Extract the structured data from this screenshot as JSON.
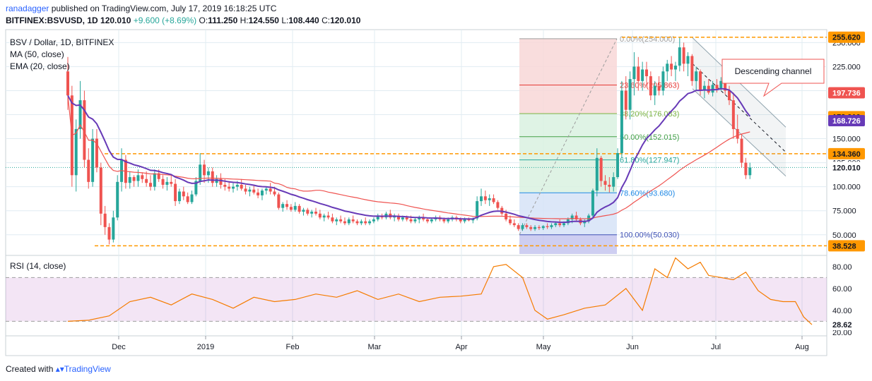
{
  "header": {
    "author": "ranadagger",
    "published_text": "published on TradingView.com, July 17, 2019 16:18:25 UTC",
    "symbol": "BITFINEX:BSVUSD, 1D",
    "close_val": "120.010",
    "change": "+9.600 (+8.69%)",
    "o_label": "O:",
    "o_val": "111.250",
    "h_label": "H:",
    "h_val": "124.550",
    "l_label": "L:",
    "l_val": "108.440",
    "c_label": "C:",
    "c_val": "120.010"
  },
  "legend": {
    "title": "BSV / Dollar, 1D, BITFINEX",
    "ma": "MA (50, close)",
    "ema": "EMA (20, close)",
    "rsi": "RSI (14, close)"
  },
  "footer": {
    "created_with": "Created with",
    "brand": "TradingView"
  },
  "colors": {
    "up": "#26a69a",
    "down": "#ef5350",
    "ma": "#ef5350",
    "ema": "#673ab7",
    "rsi": "#f57c00",
    "level": "#ff9800",
    "axis_text": "#131722",
    "grid": "#e1ecf2",
    "fib_red": "#f8d7d7",
    "fib_green": "#d9f1e0",
    "fib_blue": "#d6e3f7",
    "fib_purple": "#c5c5ef"
  },
  "chart_data": [
    {
      "type": "candlestick",
      "title": "BSV / Dollar, 1D, BITFINEX",
      "x_ticks": [
        "Dec",
        "2019",
        "Feb",
        "Mar",
        "Apr",
        "May",
        "Jun",
        "Jul",
        "Aug"
      ],
      "y_ticks": [
        "50.000",
        "75.000",
        "100.000",
        "125.000",
        "150.000",
        "175.000",
        "200.000",
        "225.000",
        "250.000"
      ],
      "ylim": [
        30,
        262
      ],
      "price_labels": [
        {
          "text": "255.620",
          "value": 255.62,
          "kind": "orange"
        },
        {
          "text": "197.736",
          "value": 197.736,
          "kind": "red"
        },
        {
          "text": "172.910",
          "value": 172.91,
          "kind": "orange"
        },
        {
          "text": "168.726",
          "value": 168.726,
          "kind": "purple"
        },
        {
          "text": "134.360",
          "value": 134.36,
          "kind": "orange"
        },
        {
          "text": "120.010",
          "value": 120.01,
          "kind": "teal"
        },
        {
          "text": "38.528",
          "value": 38.528,
          "kind": "orange"
        }
      ],
      "horizontal_levels": [
        255.62,
        134.36,
        38.528
      ],
      "fibonacci": [
        {
          "label": "0.00%(254.000)",
          "value": 254.0
        },
        {
          "label": "23.60%(205.863)",
          "value": 205.863
        },
        {
          "label": "38.20%(176.083)",
          "value": 176.083
        },
        {
          "label": "50.00%(152.015)",
          "value": 152.015
        },
        {
          "label": "61.80%(127.947)",
          "value": 127.947
        },
        {
          "label": "78.60%(93.680)",
          "value": 93.68
        },
        {
          "label": "100.00%(50.030)",
          "value": 50.03
        }
      ],
      "annotation": "Descending channel",
      "candles": [
        [
          220,
          235,
          180,
          195
        ],
        [
          195,
          205,
          100,
          112
        ],
        [
          112,
          170,
          95,
          160
        ],
        [
          160,
          210,
          150,
          190
        ],
        [
          190,
          200,
          120,
          128
        ],
        [
          128,
          140,
          98,
          105
        ],
        [
          105,
          160,
          100,
          150
        ],
        [
          150,
          160,
          115,
          120
        ],
        [
          120,
          125,
          60,
          72
        ],
        [
          72,
          80,
          50,
          58
        ],
        [
          58,
          62,
          40,
          45
        ],
        [
          45,
          75,
          42,
          68
        ],
        [
          68,
          112,
          65,
          105
        ],
        [
          105,
          140,
          95,
          128
        ],
        [
          128,
          133,
          98,
          104
        ],
        [
          104,
          116,
          98,
          110
        ],
        [
          110,
          112,
          100,
          106
        ],
        [
          106,
          118,
          100,
          112
        ],
        [
          112,
          115,
          104,
          108
        ],
        [
          108,
          116,
          100,
          104
        ],
        [
          104,
          112,
          96,
          100
        ],
        [
          100,
          118,
          96,
          114
        ],
        [
          114,
          118,
          105,
          108
        ],
        [
          108,
          112,
          98,
          102
        ],
        [
          102,
          110,
          96,
          105
        ],
        [
          105,
          112,
          100,
          103
        ],
        [
          103,
          108,
          80,
          85
        ],
        [
          85,
          98,
          82,
          95
        ],
        [
          95,
          100,
          86,
          90
        ],
        [
          90,
          94,
          82,
          84
        ],
        [
          84,
          96,
          82,
          92
        ],
        [
          92,
          110,
          90,
          106
        ],
        [
          106,
          135,
          102,
          123
        ],
        [
          123,
          128,
          104,
          112
        ],
        [
          112,
          120,
          104,
          116
        ],
        [
          116,
          120,
          100,
          104
        ],
        [
          104,
          112,
          100,
          108
        ],
        [
          108,
          114,
          98,
          102
        ],
        [
          102,
          108,
          96,
          100
        ],
        [
          100,
          106,
          95,
          98
        ],
        [
          98,
          104,
          94,
          100
        ],
        [
          100,
          106,
          96,
          102
        ],
        [
          102,
          108,
          96,
          98
        ],
        [
          98,
          102,
          92,
          95
        ],
        [
          95,
          100,
          90,
          97
        ],
        [
          97,
          102,
          92,
          94
        ],
        [
          94,
          98,
          88,
          91
        ],
        [
          91,
          98,
          86,
          96
        ],
        [
          96,
          100,
          92,
          98
        ],
        [
          98,
          104,
          92,
          95
        ],
        [
          95,
          100,
          90,
          92
        ],
        [
          92,
          94,
          76,
          78
        ],
        [
          78,
          84,
          74,
          82
        ],
        [
          82,
          86,
          76,
          79
        ],
        [
          79,
          82,
          74,
          76
        ],
        [
          76,
          84,
          74,
          80
        ],
        [
          80,
          82,
          72,
          74
        ],
        [
          74,
          78,
          70,
          76
        ],
        [
          76,
          78,
          70,
          72
        ],
        [
          72,
          76,
          68,
          74
        ],
        [
          74,
          78,
          70,
          72
        ],
        [
          72,
          76,
          66,
          68
        ],
        [
          68,
          72,
          64,
          70
        ],
        [
          70,
          74,
          66,
          68
        ],
        [
          68,
          72,
          62,
          64
        ],
        [
          64,
          68,
          60,
          66
        ],
        [
          66,
          70,
          62,
          64
        ],
        [
          64,
          68,
          60,
          62
        ],
        [
          62,
          68,
          60,
          66
        ],
        [
          66,
          70,
          62,
          64
        ],
        [
          64,
          66,
          60,
          62
        ],
        [
          62,
          66,
          60,
          64
        ],
        [
          64,
          68,
          60,
          62
        ],
        [
          62,
          66,
          60,
          64
        ],
        [
          64,
          68,
          62,
          66
        ],
        [
          66,
          72,
          64,
          70
        ],
        [
          70,
          72,
          66,
          68
        ],
        [
          68,
          74,
          66,
          72
        ],
        [
          72,
          76,
          66,
          68
        ],
        [
          68,
          72,
          64,
          70
        ],
        [
          70,
          72,
          64,
          66
        ],
        [
          66,
          70,
          64,
          68
        ],
        [
          68,
          70,
          64,
          66
        ],
        [
          66,
          70,
          62,
          64
        ],
        [
          64,
          68,
          62,
          66
        ],
        [
          66,
          70,
          62,
          68
        ],
        [
          68,
          72,
          64,
          66
        ],
        [
          66,
          68,
          62,
          64
        ],
        [
          64,
          68,
          62,
          66
        ],
        [
          66,
          70,
          64,
          68
        ],
        [
          68,
          70,
          64,
          66
        ],
        [
          66,
          68,
          62,
          64
        ],
        [
          64,
          68,
          62,
          66
        ],
        [
          66,
          70,
          64,
          68
        ],
        [
          68,
          70,
          64,
          66
        ],
        [
          66,
          68,
          62,
          64
        ],
        [
          64,
          68,
          62,
          66
        ],
        [
          66,
          68,
          64,
          65
        ],
        [
          65,
          68,
          62,
          67
        ],
        [
          67,
          90,
          65,
          85
        ],
        [
          85,
          98,
          80,
          90
        ],
        [
          90,
          96,
          82,
          86
        ],
        [
          86,
          92,
          80,
          88
        ],
        [
          88,
          92,
          82,
          84
        ],
        [
          84,
          86,
          76,
          78
        ],
        [
          78,
          80,
          70,
          72
        ],
        [
          72,
          76,
          64,
          66
        ],
        [
          66,
          70,
          60,
          62
        ],
        [
          62,
          66,
          58,
          60
        ],
        [
          60,
          62,
          54,
          56
        ],
        [
          56,
          62,
          54,
          60
        ],
        [
          60,
          62,
          56,
          58
        ],
        [
          58,
          60,
          54,
          56
        ],
        [
          56,
          60,
          54,
          58
        ],
        [
          58,
          60,
          55,
          57
        ],
        [
          57,
          60,
          55,
          59
        ],
        [
          59,
          62,
          56,
          58
        ],
        [
          58,
          62,
          56,
          60
        ],
        [
          60,
          64,
          58,
          62
        ],
        [
          62,
          66,
          58,
          60
        ],
        [
          60,
          64,
          58,
          62
        ],
        [
          62,
          68,
          60,
          66
        ],
        [
          66,
          72,
          62,
          70
        ],
        [
          70,
          74,
          64,
          66
        ],
        [
          66,
          68,
          60,
          62
        ],
        [
          62,
          66,
          58,
          64
        ],
        [
          64,
          72,
          62,
          70
        ],
        [
          70,
          98,
          68,
          96
        ],
        [
          96,
          140,
          90,
          130
        ],
        [
          130,
          132,
          100,
          106
        ],
        [
          106,
          112,
          96,
          102
        ],
        [
          102,
          110,
          94,
          100
        ],
        [
          100,
          115,
          95,
          110
        ],
        [
          110,
          140,
          108,
          135
        ],
        [
          135,
          210,
          130,
          200
        ],
        [
          200,
          215,
          170,
          180
        ],
        [
          180,
          220,
          170,
          212
        ],
        [
          212,
          240,
          195,
          225
        ],
        [
          225,
          235,
          200,
          210
        ],
        [
          210,
          230,
          200,
          222
        ],
        [
          222,
          230,
          205,
          215
        ],
        [
          215,
          220,
          190,
          195
        ],
        [
          195,
          210,
          185,
          205
        ],
        [
          205,
          215,
          195,
          200
        ],
        [
          200,
          225,
          195,
          220
        ],
        [
          220,
          232,
          210,
          228
        ],
        [
          228,
          236,
          215,
          222
        ],
        [
          222,
          230,
          210,
          226
        ],
        [
          226,
          255,
          220,
          245
        ],
        [
          245,
          250,
          220,
          228
        ],
        [
          228,
          240,
          215,
          236
        ],
        [
          236,
          238,
          205,
          210
        ],
        [
          210,
          225,
          200,
          220
        ],
        [
          220,
          222,
          195,
          200
        ],
        [
          200,
          210,
          192,
          205
        ],
        [
          205,
          212,
          196,
          198
        ],
        [
          198,
          210,
          194,
          206
        ],
        [
          206,
          212,
          198,
          202
        ],
        [
          202,
          214,
          200,
          210
        ],
        [
          210,
          212,
          196,
          200
        ],
        [
          200,
          205,
          185,
          190
        ],
        [
          190,
          198,
          150,
          160
        ],
        [
          160,
          175,
          145,
          150
        ],
        [
          150,
          155,
          120,
          125
        ],
        [
          125,
          130,
          108,
          112
        ],
        [
          112,
          125,
          108,
          120
        ]
      ]
    },
    {
      "type": "line",
      "title": "RSI (14, close)",
      "y_ticks": [
        "20.00",
        "40.00",
        "60.00",
        "80.00"
      ],
      "ylim": [
        18,
        89
      ],
      "bands": [
        30,
        70
      ],
      "last_label": "28.62",
      "x": [
        0,
        5,
        10,
        15,
        20,
        25,
        30,
        35,
        40,
        45,
        50,
        55,
        60,
        65,
        70,
        75,
        80,
        85,
        90,
        95,
        100,
        103,
        106,
        110,
        113,
        116,
        120,
        125,
        130,
        135,
        139,
        142,
        145,
        147,
        150,
        153,
        155,
        158,
        161,
        164,
        167,
        170,
        173,
        176,
        178,
        180
      ],
      "values": [
        30,
        31,
        35,
        48,
        52,
        45,
        55,
        50,
        42,
        52,
        48,
        50,
        55,
        52,
        58,
        50,
        55,
        48,
        52,
        53,
        55,
        80,
        82,
        70,
        40,
        32,
        36,
        42,
        45,
        60,
        40,
        78,
        70,
        88,
        78,
        84,
        72,
        70,
        68,
        75,
        58,
        50,
        48,
        48,
        34,
        27
      ]
    }
  ]
}
